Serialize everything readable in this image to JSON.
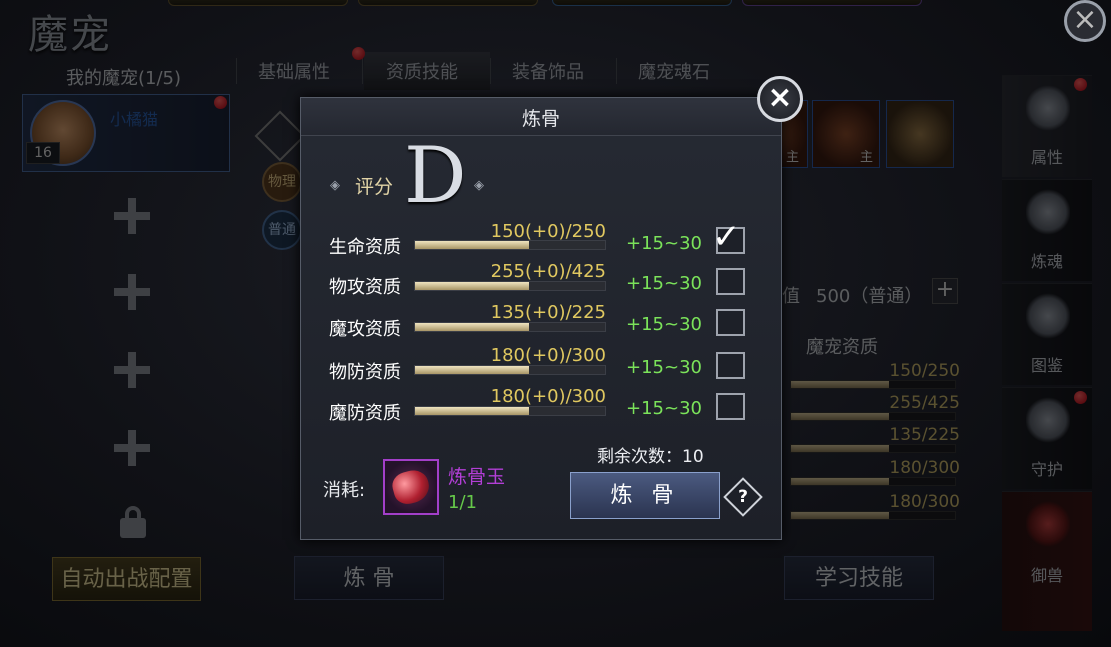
{
  "window": {
    "title": "魔宠",
    "close_icon": "close-icon"
  },
  "left_panel": {
    "my_pets_label": "我的魔宠(1/5)",
    "pet": {
      "level": "16",
      "name": "小橘猫"
    },
    "auto_battle_button": "自动出战配置"
  },
  "tabs": [
    {
      "label": "基础属性"
    },
    {
      "label": "资质技能"
    },
    {
      "label": "装备饰品"
    },
    {
      "label": "魔宠魂石"
    }
  ],
  "mid_badges": {
    "physical": "物理",
    "normal": "普通"
  },
  "skills": [
    {
      "label": "主"
    },
    {
      "label": "主"
    }
  ],
  "behind": {
    "value_text": "值",
    "points_text": "500（普通）",
    "pet_stats_title": "魔宠资质",
    "stat_values": [
      "150/250",
      "255/425",
      "135/225",
      "180/300",
      "180/300"
    ],
    "stat_fill": [
      0.6,
      0.6,
      0.6,
      0.6,
      0.6
    ],
    "refine_bottom_button": "炼 骨",
    "learn_skill_button": "学习技能"
  },
  "side_tabs": [
    {
      "label": "属性",
      "icon": "demon-mask-icon"
    },
    {
      "label": "炼魂",
      "icon": "flame-icon"
    },
    {
      "label": "图鉴",
      "icon": "scroll-icon"
    },
    {
      "label": "守护",
      "icon": "swirl-icon"
    },
    {
      "label": "御兽",
      "icon": "beast-icon"
    }
  ],
  "dialog": {
    "title": "炼骨",
    "rating_label": "评分",
    "rating_grade": "D",
    "stats": [
      {
        "label": "生命资质",
        "value": "150(+0)/250",
        "fill": 0.6,
        "bonus": "+15~30",
        "checked": true
      },
      {
        "label": "物攻资质",
        "value": "255(+0)/425",
        "fill": 0.6,
        "bonus": "+15~30",
        "checked": false
      },
      {
        "label": "魔攻资质",
        "value": "135(+0)/225",
        "fill": 0.6,
        "bonus": "+15~30",
        "checked": false
      },
      {
        "label": "物防资质",
        "value": "180(+0)/300",
        "fill": 0.6,
        "bonus": "+15~30",
        "checked": false
      },
      {
        "label": "魔防资质",
        "value": "180(+0)/300",
        "fill": 0.6,
        "bonus": "+15~30",
        "checked": false
      }
    ],
    "cost_label": "消耗:",
    "item_name": "炼骨玉",
    "item_count": "1/1",
    "remaining": "剩余次数：10",
    "refine_button": "炼 骨",
    "help": "?"
  }
}
